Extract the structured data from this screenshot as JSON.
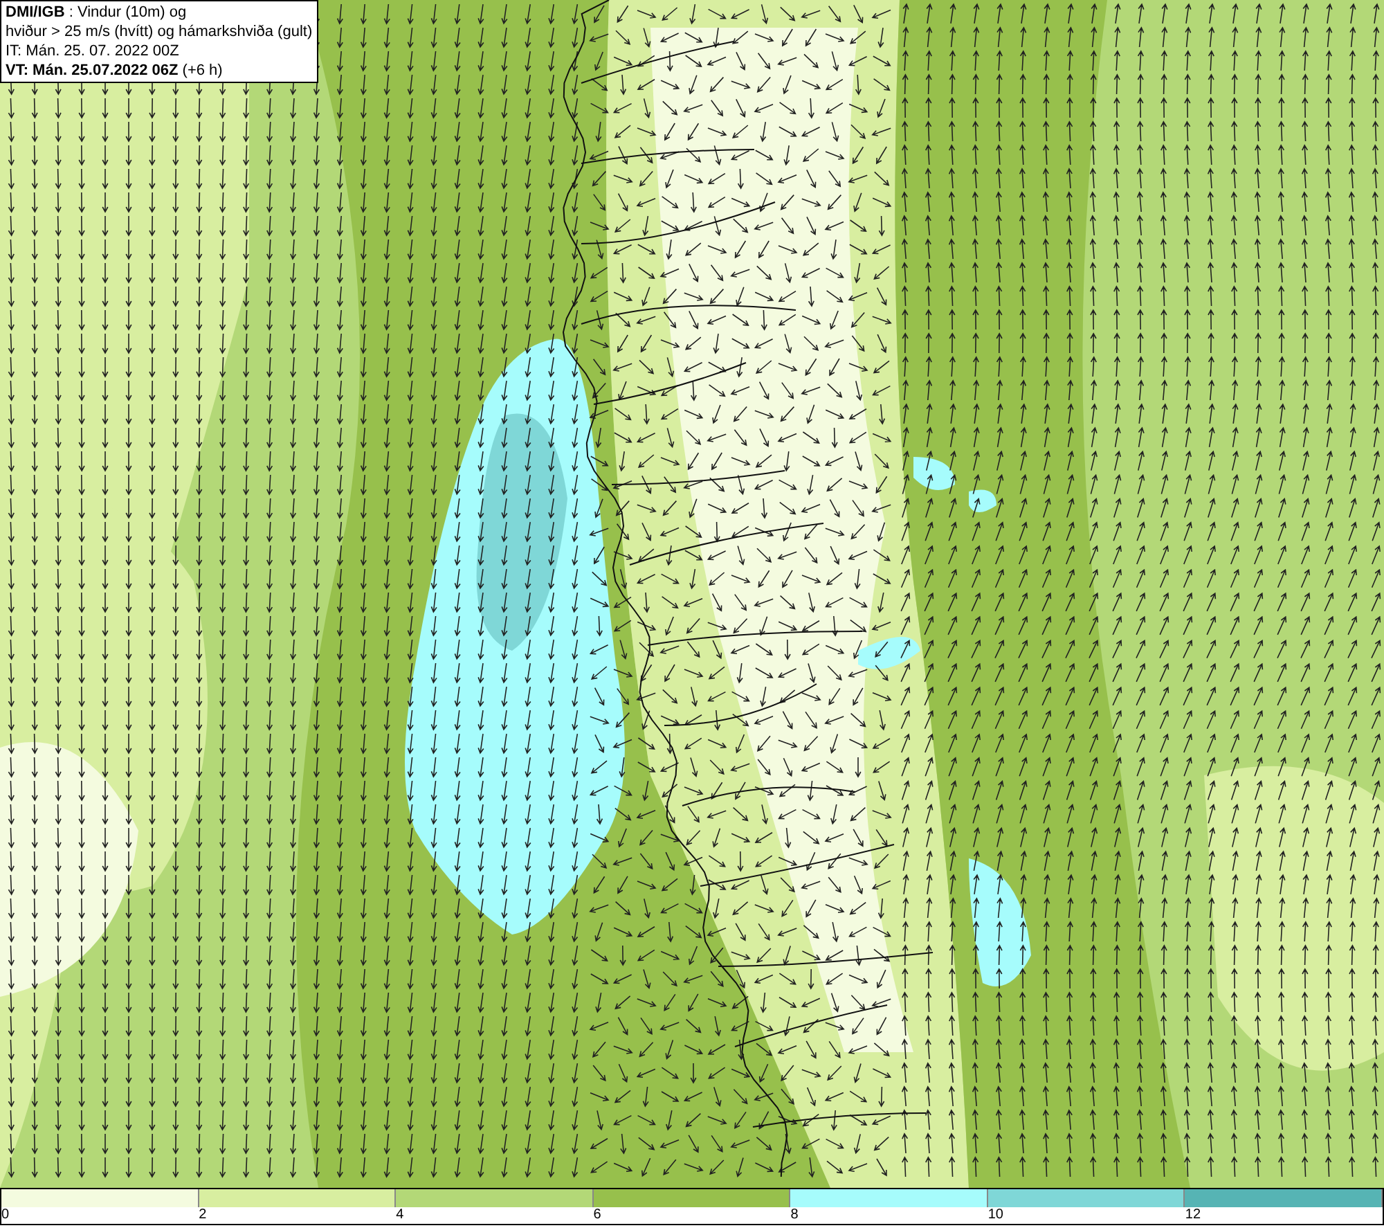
{
  "header": {
    "lines": [
      "**DMI/IGB** : Vindur (10m) og",
      "hviður > 25 m/s (hvítt) og hámarkshviða (gult)",
      "IT: Mán. 25. 07. 2022 00Z",
      "**VT: Mán. 25.07.2022 06Z** (+6 h)"
    ]
  },
  "legend": {
    "bins": [
      {
        "color": "#f4fbdf"
      },
      {
        "color": "#d8eea0"
      },
      {
        "color": "#b3d877"
      },
      {
        "color": "#97c04c"
      },
      {
        "color": "#a6fcfc"
      },
      {
        "color": "#7fd7d7"
      },
      {
        "color": "#56b4b4"
      }
    ],
    "ticks": [
      "0",
      "2",
      "4",
      "6",
      "8",
      "10",
      "12"
    ]
  }
}
